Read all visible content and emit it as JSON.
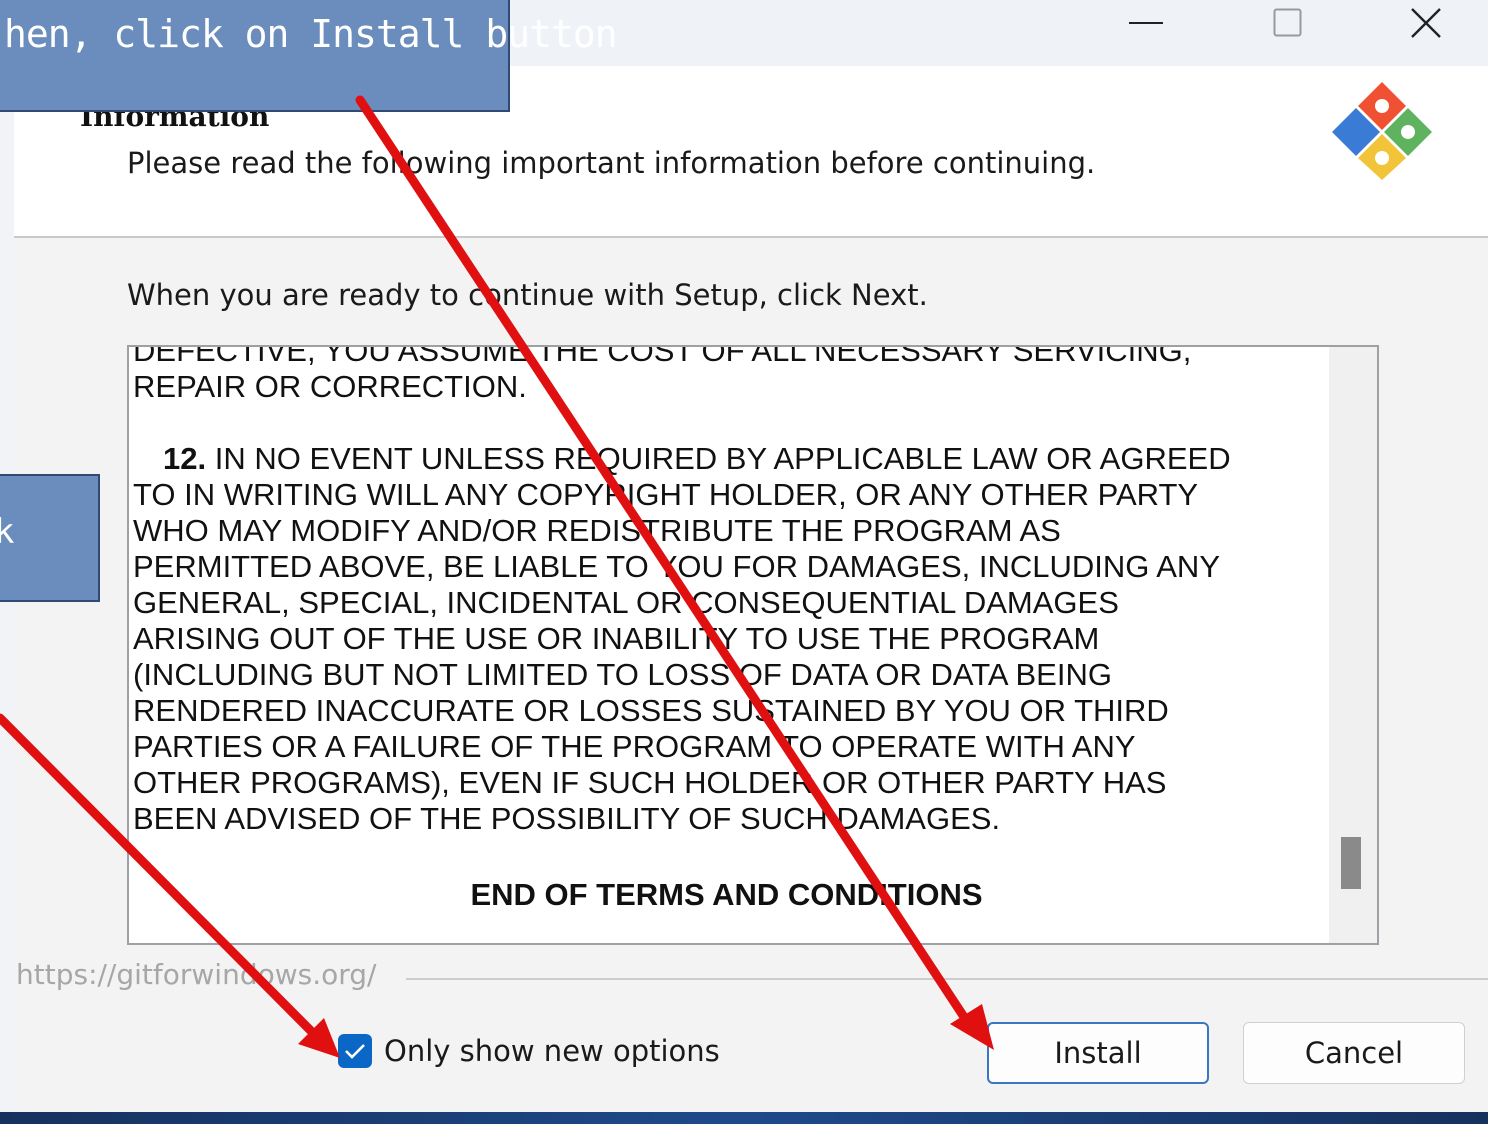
{
  "window": {
    "controls": {
      "minimize": "—",
      "maximize": "☐",
      "close": "✕"
    }
  },
  "header": {
    "title": "Information",
    "subtitle": "Please read the following important information before continuing.",
    "logo_icon": "git-logo-icon"
  },
  "body": {
    "instruction": "When you are ready to continue with Setup, click Next.",
    "memo": {
      "lines_top": [
        "DEFECTIVE, YOU ASSUME THE COST OF ALL NECESSARY SERVICING,",
        "REPAIR OR CORRECTION."
      ],
      "clause_number": "12.",
      "clause_first_line": "IN NO EVENT UNLESS REQUIRED BY APPLICABLE LAW OR AGREED",
      "clause_lines": [
        "TO IN WRITING WILL ANY COPYRIGHT HOLDER, OR ANY OTHER PARTY",
        "WHO MAY MODIFY AND/OR REDISTRIBUTE THE PROGRAM AS",
        "PERMITTED ABOVE, BE LIABLE TO YOU FOR DAMAGES, INCLUDING ANY",
        "GENERAL, SPECIAL, INCIDENTAL OR CONSEQUENTIAL DAMAGES",
        "ARISING OUT OF THE USE OR INABILITY TO USE THE PROGRAM",
        "(INCLUDING BUT NOT LIMITED TO LOSS OF DATA OR DATA BEING",
        "RENDERED INACCURATE OR LOSSES SUSTAINED BY YOU OR THIRD",
        "PARTIES OR A FAILURE OF THE PROGRAM TO OPERATE WITH ANY",
        "OTHER PROGRAMS), EVEN IF SUCH HOLDER OR OTHER PARTY HAS",
        "BEEN ADVISED OF THE POSSIBILITY OF SUCH DAMAGES."
      ],
      "end_title": "END OF TERMS AND CONDITIONS"
    }
  },
  "footer": {
    "url": "https://gitforwindows.org/",
    "checkbox_label": "Only show new options",
    "checkbox_checked": true,
    "install_label": "Install",
    "cancel_label": "Cancel"
  },
  "annotations": {
    "callout_top": "hen, click on Install button",
    "callout_left": "k"
  },
  "colors": {
    "accent": "#0b67c6",
    "callout_fill": "#6a8dbd",
    "arrow": "#e01010"
  }
}
